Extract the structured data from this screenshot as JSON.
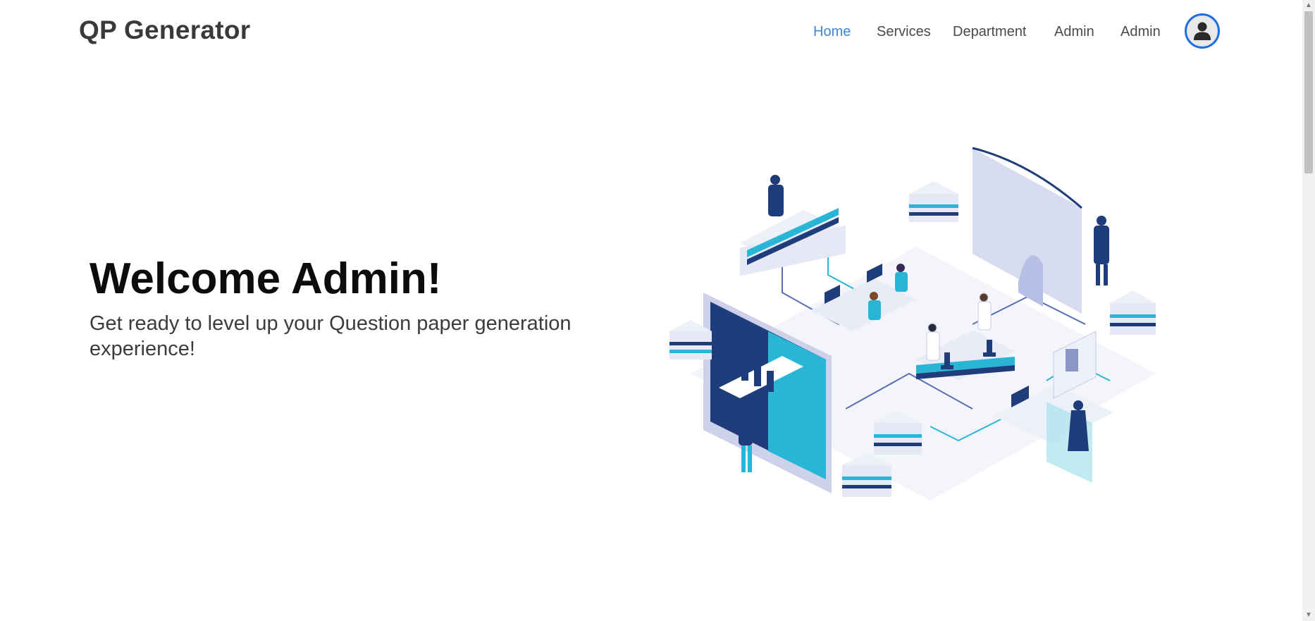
{
  "brand": "QP Generator",
  "nav": {
    "items": [
      "Home",
      "Services",
      "Department",
      "Admin",
      "Admin"
    ],
    "active": "Home"
  },
  "avatar_icon": "user-icon",
  "hero": {
    "title": "Welcome Admin!",
    "subtitle": "Get ready to level up your Question paper generation experience!"
  },
  "illustration_icon": "isometric-lab-illustration",
  "colors": {
    "accent": "#3f86d6",
    "avatar_ring": "#1f6fe0",
    "navy": "#1e3d7a",
    "cyan": "#29b6d6",
    "pale": "#e6e8f5"
  }
}
